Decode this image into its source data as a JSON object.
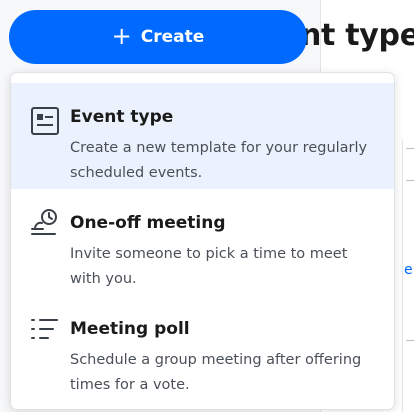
{
  "create_button": {
    "icon": "plus-icon",
    "icon_glyph": "+",
    "label": "Create"
  },
  "background": {
    "heading_partial": "nt type",
    "link_partial": "e"
  },
  "menu": {
    "items": [
      {
        "icon": "event-type-icon",
        "title": "Event type",
        "description": "Create a new template for your regularly scheduled events."
      },
      {
        "icon": "one-off-meeting-icon",
        "title": "One-off meeting",
        "description": "Invite someone to pick a time to meet with you."
      },
      {
        "icon": "meeting-poll-icon",
        "title": "Meeting poll",
        "description": "Schedule a group meeting after offering times for a vote."
      }
    ]
  },
  "colors": {
    "primary": "#0069ff",
    "active_item_bg": "#ebf2fd",
    "text_primary": "#1a1a1a",
    "text_secondary": "#4b5058"
  }
}
